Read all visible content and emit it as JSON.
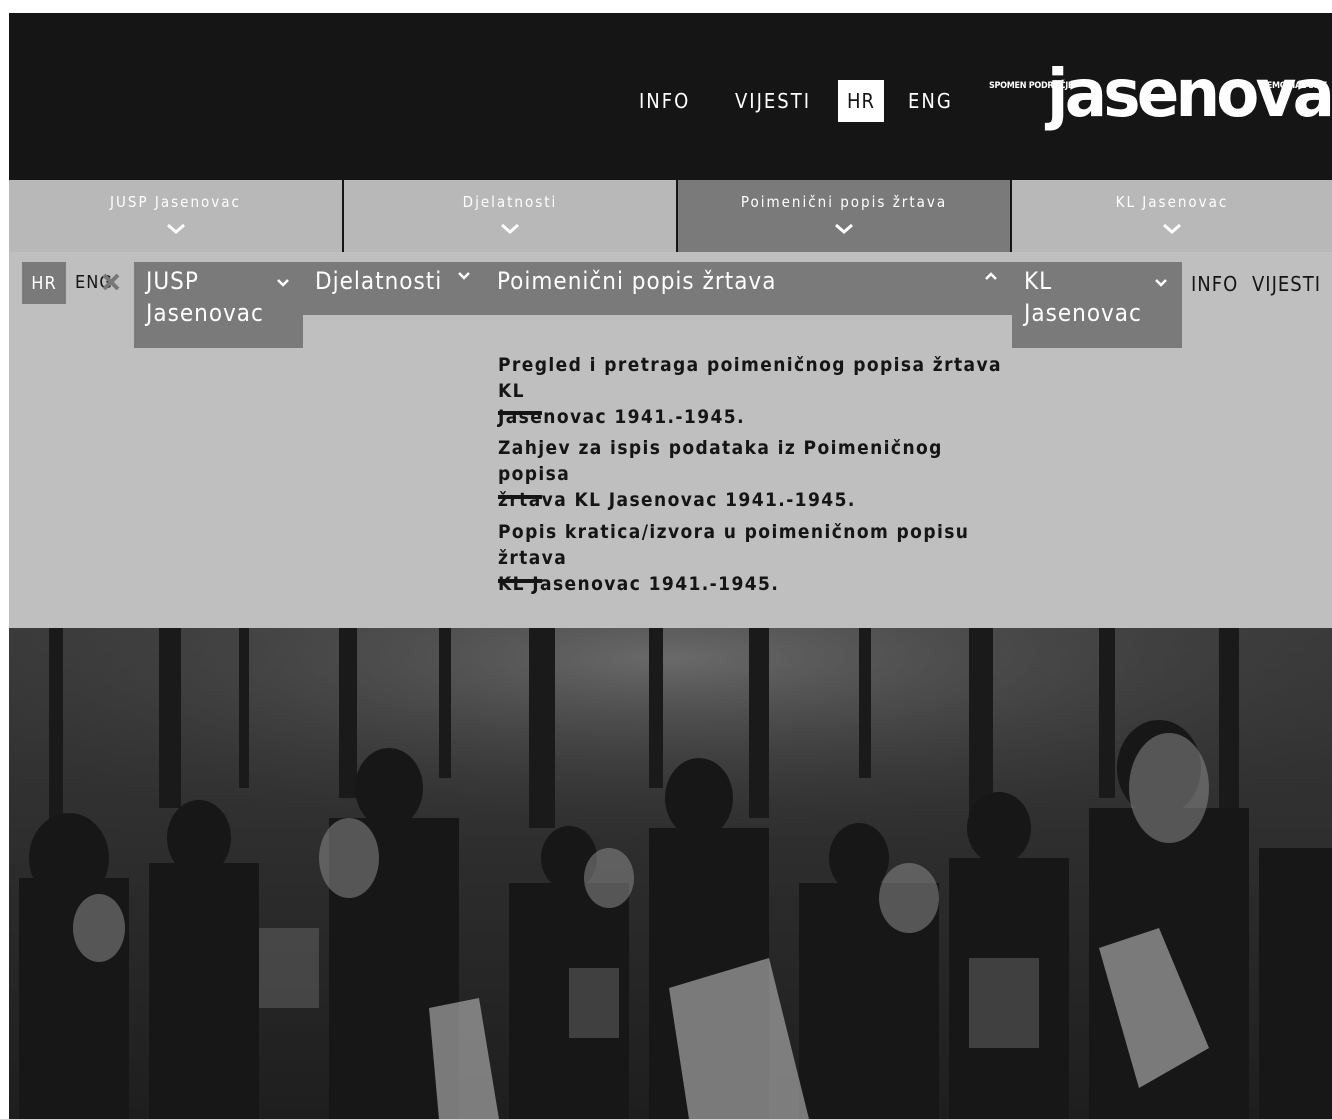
{
  "header": {
    "nav": {
      "info": "INFO",
      "news": "VIJESTI"
    },
    "languages": {
      "active": "HR",
      "other": "ENG"
    },
    "logo": {
      "left": "SPOMEN PODRUČJE",
      "main": "jasenovac",
      "right": "MEMORIAL SITE"
    }
  },
  "tabs": [
    {
      "label": "JUSP Jasenovac"
    },
    {
      "label": "Djelatnosti"
    },
    {
      "label": "Poimenični popis žrtava"
    },
    {
      "label": "KL Jasenovac"
    }
  ],
  "dropdown": {
    "languages": {
      "active": "HR",
      "other": "ENG"
    },
    "menu": {
      "jusp_line1": "JUSP",
      "jusp_line2": "Jasenovac",
      "djelatnosti": "Djelatnosti",
      "poimenicni": "Poimenični popis žrtava",
      "kl_line1": "KL",
      "kl_line2": "Jasenovac"
    },
    "info": "INFO",
    "news": "VIJESTI",
    "links": [
      {
        "line1": "Pregled i pretraga poimeničnog popisa žrtava KL",
        "line2": "Jasenovac 1941.-1945."
      },
      {
        "line1": "Zahjev za ispis podataka iz Poimeničnog popisa",
        "line2": "žrtava KL Jasenovac 1941.-1945."
      },
      {
        "line1": "Popis kratica/izvora u poimeničnom popisu žrtava",
        "line2": "KL Jasenovac 1941.-1945."
      }
    ]
  },
  "colors": {
    "header_bg": "#151515",
    "tab_bg": "#b8b8b8",
    "tab_active_bg": "#7a7a7a",
    "panel_bg": "#bfbfbf",
    "text_dark": "#151515"
  },
  "icons": {
    "tab_chevron": "chevron-down-icon",
    "close": "close-icon",
    "menu_up": "chevron-up-icon"
  }
}
